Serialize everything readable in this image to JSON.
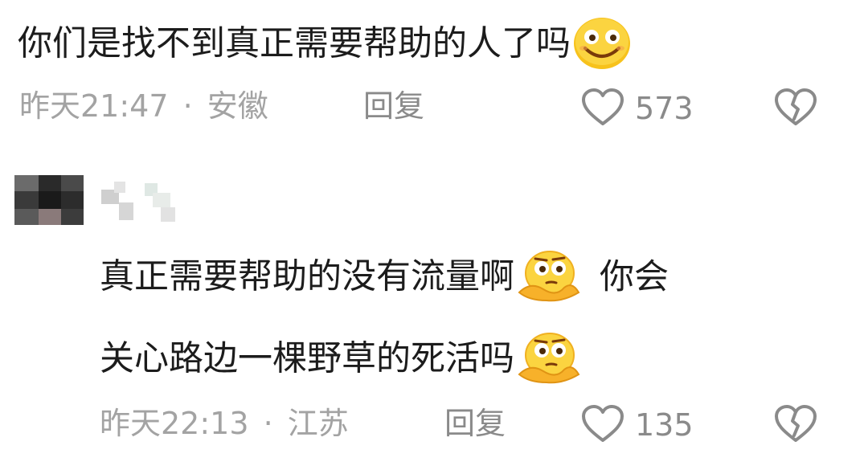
{
  "comments": [
    {
      "text": "你们是找不到真正需要帮助的人了吗",
      "emoji": "smiling-face-icon",
      "time": "昨天21:47",
      "separator": "·",
      "location": "安徽",
      "reply_label": "回复",
      "likes": "573"
    },
    {
      "line1": "真正需要帮助的没有流量啊",
      "line1_tail": "你会",
      "line2": "关心路边一棵野草的死活吗",
      "emoji": "thinking-face-icon",
      "time": "昨天22:13",
      "separator": "·",
      "location": "江苏",
      "reply_label": "回复",
      "likes": "135"
    }
  ]
}
